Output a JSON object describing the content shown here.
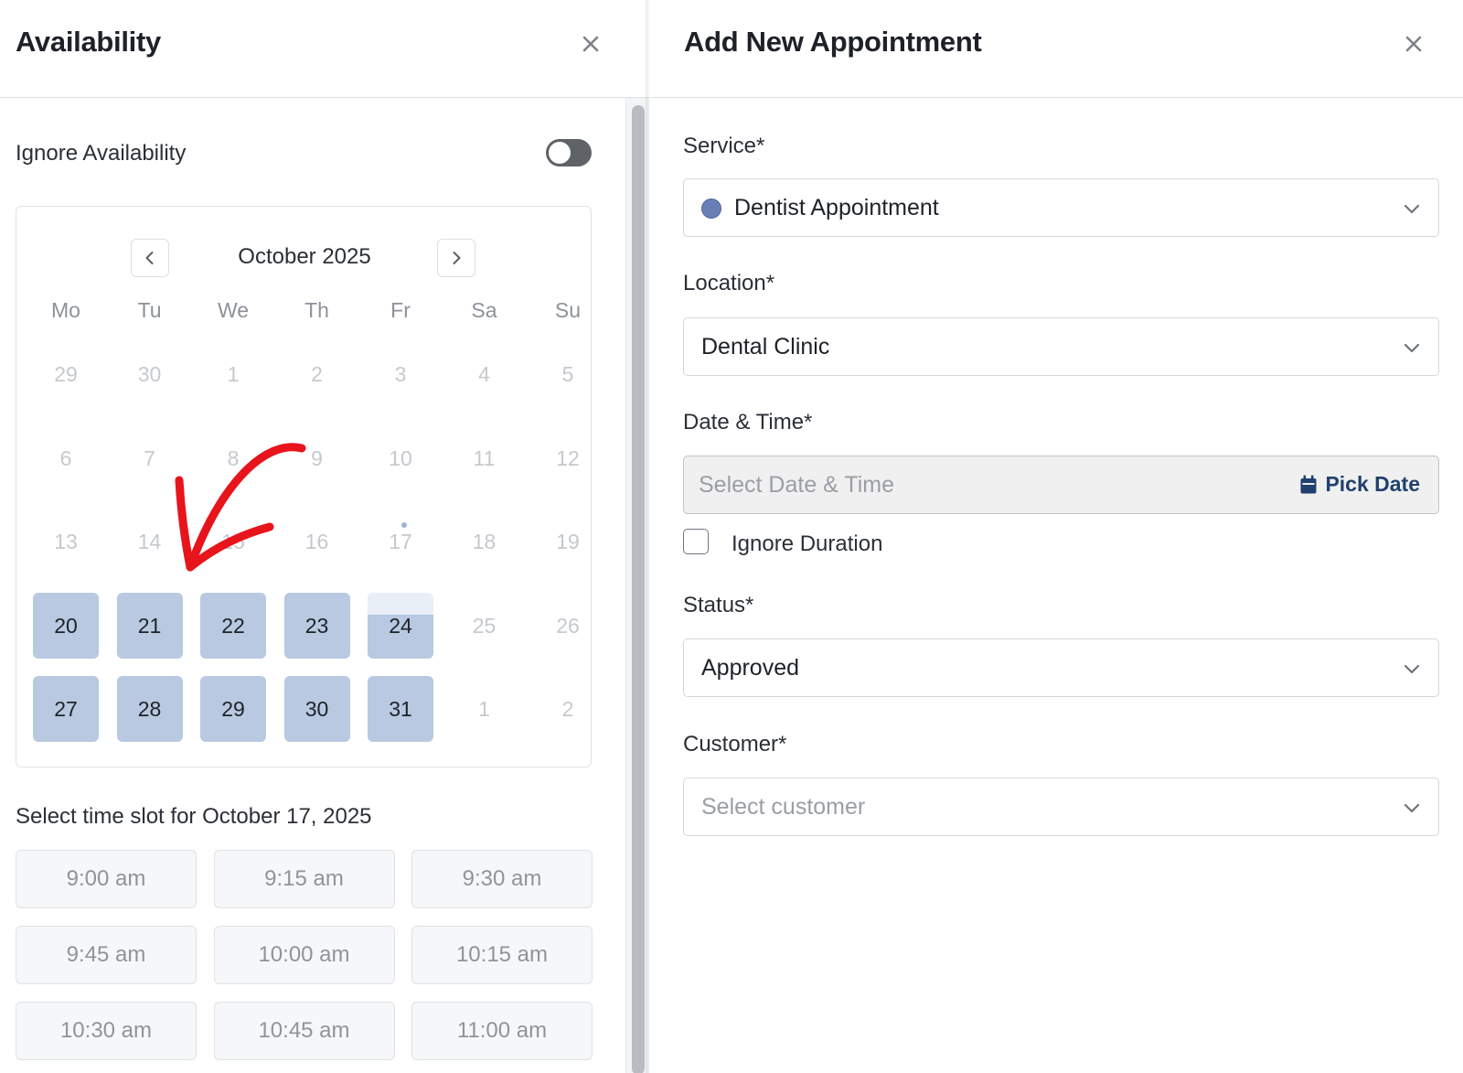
{
  "availability_panel": {
    "title": "Availability",
    "ignore_availability": {
      "label": "Ignore Availability",
      "on": false
    },
    "calendar": {
      "month_label": "October 2025",
      "weekdays": [
        "Mo",
        "Tu",
        "We",
        "Th",
        "Fr",
        "Sa",
        "Su"
      ],
      "weeks": [
        [
          "29",
          "30",
          "1",
          "2",
          "3",
          "4",
          "5"
        ],
        [
          "6",
          "7",
          "8",
          "9",
          "10",
          "11",
          "12"
        ],
        [
          "13",
          "14",
          "15",
          "16",
          "17",
          "18",
          "19"
        ],
        [
          "20",
          "21",
          "22",
          "23",
          "24",
          "25",
          "26"
        ],
        [
          "27",
          "28",
          "29",
          "30",
          "31",
          "1",
          "2"
        ]
      ],
      "available_days": [
        "20",
        "21",
        "22",
        "23",
        "24",
        "27",
        "28",
        "29",
        "30",
        "31"
      ],
      "highlight_color": "#b8c9e1"
    },
    "time_slot_title": "Select time slot for October 17, 2025",
    "time_slots": [
      "9:00 am",
      "9:15 am",
      "9:30 am",
      "9:45 am",
      "10:00 am",
      "10:15 am",
      "10:30 am",
      "10:45 am",
      "11:00 am"
    ]
  },
  "appointment_panel": {
    "title": "Add New Appointment",
    "service": {
      "label": "Service*",
      "value": "Dentist Appointment",
      "dot_color": "#6a7fb5"
    },
    "location": {
      "label": "Location*",
      "value": "Dental Clinic"
    },
    "date_time": {
      "label": "Date & Time*",
      "placeholder": "Select Date & Time",
      "pick_label": "Pick Date"
    },
    "ignore_duration": {
      "label": "Ignore Duration",
      "checked": false
    },
    "status": {
      "label": "Status*",
      "value": "Approved"
    },
    "customer": {
      "label": "Customer*",
      "placeholder": "Select customer"
    }
  },
  "colors": {
    "accent_blue": "#20416e",
    "annotation_red": "#e8141c"
  }
}
